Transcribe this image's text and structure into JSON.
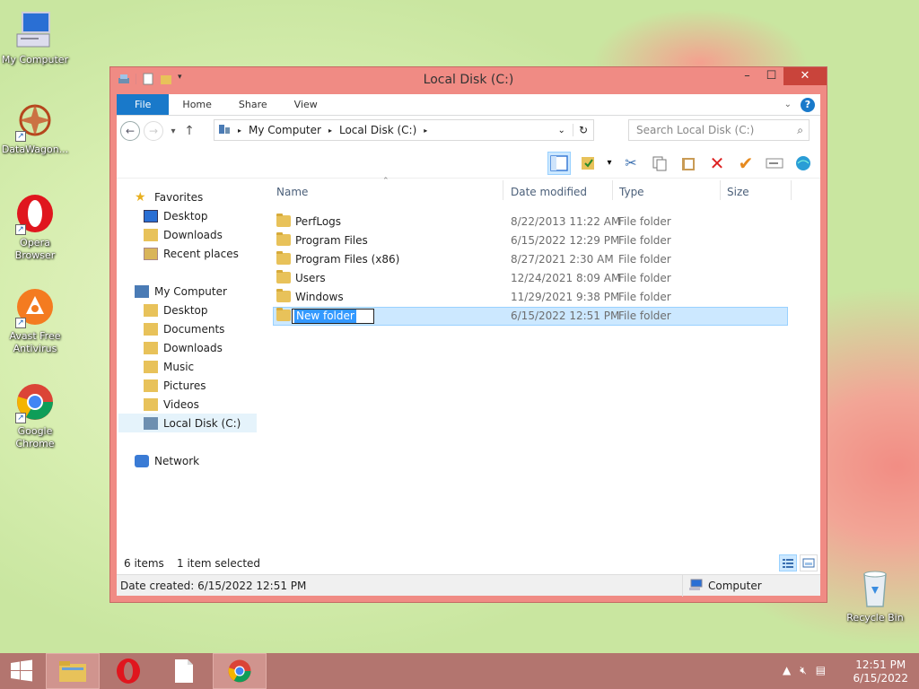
{
  "desktop": {
    "icons": [
      {
        "label": "My Computer",
        "icon": "computer-icon"
      },
      {
        "label": "DataWagon...",
        "icon": "datawagon-icon"
      },
      {
        "label": "Opera Browser",
        "icon": "opera-icon"
      },
      {
        "label": "Avast Free Antivirus",
        "icon": "avast-icon"
      },
      {
        "label": "Google Chrome",
        "icon": "chrome-icon"
      },
      {
        "label": "Recycle Bin",
        "icon": "recycle-bin-icon"
      }
    ]
  },
  "window": {
    "title": "Local Disk (C:)",
    "ribbon_tabs": [
      "File",
      "Home",
      "Share",
      "View"
    ],
    "address": {
      "segments": [
        "My Computer",
        "Local Disk (C:)"
      ]
    },
    "search": {
      "placeholder": "Search Local Disk (C:)"
    },
    "nav_pane": {
      "favorites": {
        "label": "Favorites",
        "items": [
          "Desktop",
          "Downloads",
          "Recent places"
        ]
      },
      "computer": {
        "label": "My Computer",
        "items": [
          "Desktop",
          "Documents",
          "Downloads",
          "Music",
          "Pictures",
          "Videos",
          "Local Disk (C:)"
        ]
      },
      "network": {
        "label": "Network"
      }
    },
    "columns": [
      "Name",
      "Date modified",
      "Type",
      "Size"
    ],
    "files": [
      {
        "name": "PerfLogs",
        "date": "8/22/2013 11:22 AM",
        "type": "File folder"
      },
      {
        "name": "Program Files",
        "date": "6/15/2022 12:29 PM",
        "type": "File folder"
      },
      {
        "name": "Program Files (x86)",
        "date": "8/27/2021 2:30 AM",
        "type": "File folder"
      },
      {
        "name": "Users",
        "date": "12/24/2021 8:09 AM",
        "type": "File folder"
      },
      {
        "name": "Windows",
        "date": "11/29/2021 9:38 PM",
        "type": "File folder"
      },
      {
        "name": "New folder",
        "date": "6/15/2022 12:51 PM",
        "type": "File folder",
        "renaming": true
      }
    ],
    "status": {
      "count": "6 items",
      "selected": "1 item selected"
    },
    "details_bar": {
      "date_created": "Date created: 6/15/2022 12:51 PM",
      "zone": "Computer"
    }
  },
  "taskbar": {
    "items": [
      "start-button",
      "file-explorer",
      "opera",
      "notepad",
      "chrome"
    ],
    "clock": {
      "time": "12:51 PM",
      "date": "6/15/2022"
    }
  },
  "colors": {
    "window_frame": "#f08b84",
    "file_tab": "#1979ca",
    "selection": "#cce8ff",
    "taskbar": "#b3756f"
  }
}
